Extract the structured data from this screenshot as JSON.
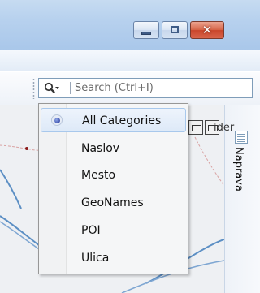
{
  "window": {
    "close_glyph": "✕",
    "icons": [
      "minimize-icon",
      "maximize-icon",
      "close-icon"
    ],
    "title_bar_color": "#b7d1ee",
    "close_color": "#d0553a"
  },
  "search": {
    "placeholder": "Search (Ctrl+I)",
    "value": "",
    "icon": "magnifier-icon"
  },
  "dropdown": {
    "selected_index": 0,
    "items": [
      {
        "label": "All Categories",
        "selected": true
      },
      {
        "label": "Naslov",
        "selected": false
      },
      {
        "label": "Mesto",
        "selected": false
      },
      {
        "label": "GeoNames",
        "selected": false
      },
      {
        "label": "POI",
        "selected": false
      },
      {
        "label": "Ulica",
        "selected": false
      }
    ]
  },
  "map": {
    "label_fragment": "ider",
    "river_color": "#5c8fc4"
  },
  "side_panel": {
    "label": "Naprava",
    "icon": "list-icon"
  }
}
